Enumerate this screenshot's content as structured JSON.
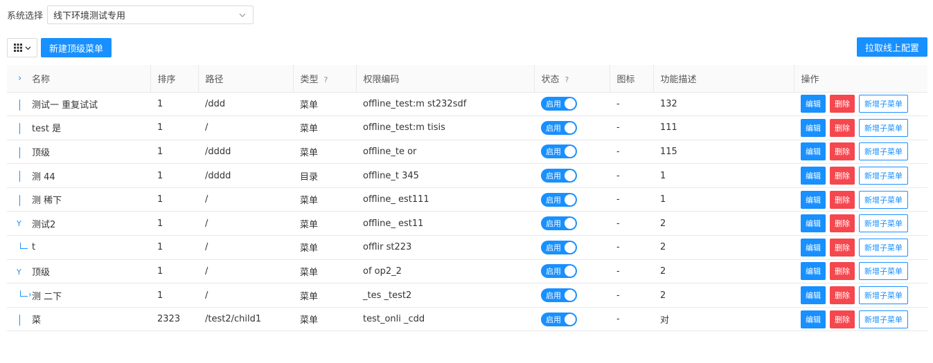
{
  "system": {
    "label": "系统选择",
    "selected": "线下环境测试专用"
  },
  "toolbar": {
    "new_top_menu": "新建顶级菜单",
    "pull_config": "拉取线上配置"
  },
  "columns": [
    "名称",
    "排序",
    "路径",
    "类型",
    "权限编码",
    "状态",
    "图标",
    "功能描述",
    "操作"
  ],
  "status_label": "启用",
  "ops": {
    "edit": "编辑",
    "delete": "删除",
    "add_child": "新增子菜单"
  },
  "rows": [
    {
      "name": "测试一 重复试试",
      "sort": "1",
      "path": "/ddd",
      "type": "菜单",
      "code": "offline_test:m st232sdf",
      "icon": "-",
      "desc": "132"
    },
    {
      "name": "test 是",
      "sort": "1",
      "path": "/",
      "type": "菜单",
      "code": "offline_test:m tisis",
      "icon": "-",
      "desc": "111"
    },
    {
      "name": "顶级",
      "sort": "1",
      "path": "/dddd",
      "type": "菜单",
      "code": "offline_te or",
      "icon": "-",
      "desc": "115"
    },
    {
      "name": "测 44",
      "sort": "1",
      "path": "/dddd",
      "type": "目录",
      "code": "offline_t 345",
      "icon": "-",
      "desc": "1"
    },
    {
      "name": "测 稀下",
      "sort": "1",
      "path": "/",
      "type": "菜单",
      "code": "offline_ est111",
      "icon": "-",
      "desc": "1"
    },
    {
      "name": "测试2",
      "sort": "1",
      "path": "/",
      "type": "菜单",
      "code": "offline_ est11",
      "icon": "-",
      "desc": "2"
    },
    {
      "name": "t",
      "sort": "1",
      "path": "/",
      "type": "菜单",
      "code": "offlir st223",
      "icon": "-",
      "desc": "2"
    },
    {
      "name": "顶级",
      "sort": "1",
      "path": "/",
      "type": "菜单",
      "code": "of op2_2",
      "icon": "-",
      "desc": "2"
    },
    {
      "name": "测 二下",
      "sort": "1",
      "path": "/",
      "type": "菜单",
      "code": "_tes _test2",
      "icon": "-",
      "desc": "2"
    },
    {
      "name": "菜",
      "sort": "2323",
      "path": "/test2/child1",
      "type": "菜单",
      "code": "test_onli _cdd",
      "icon": "-",
      "desc": "对"
    }
  ]
}
